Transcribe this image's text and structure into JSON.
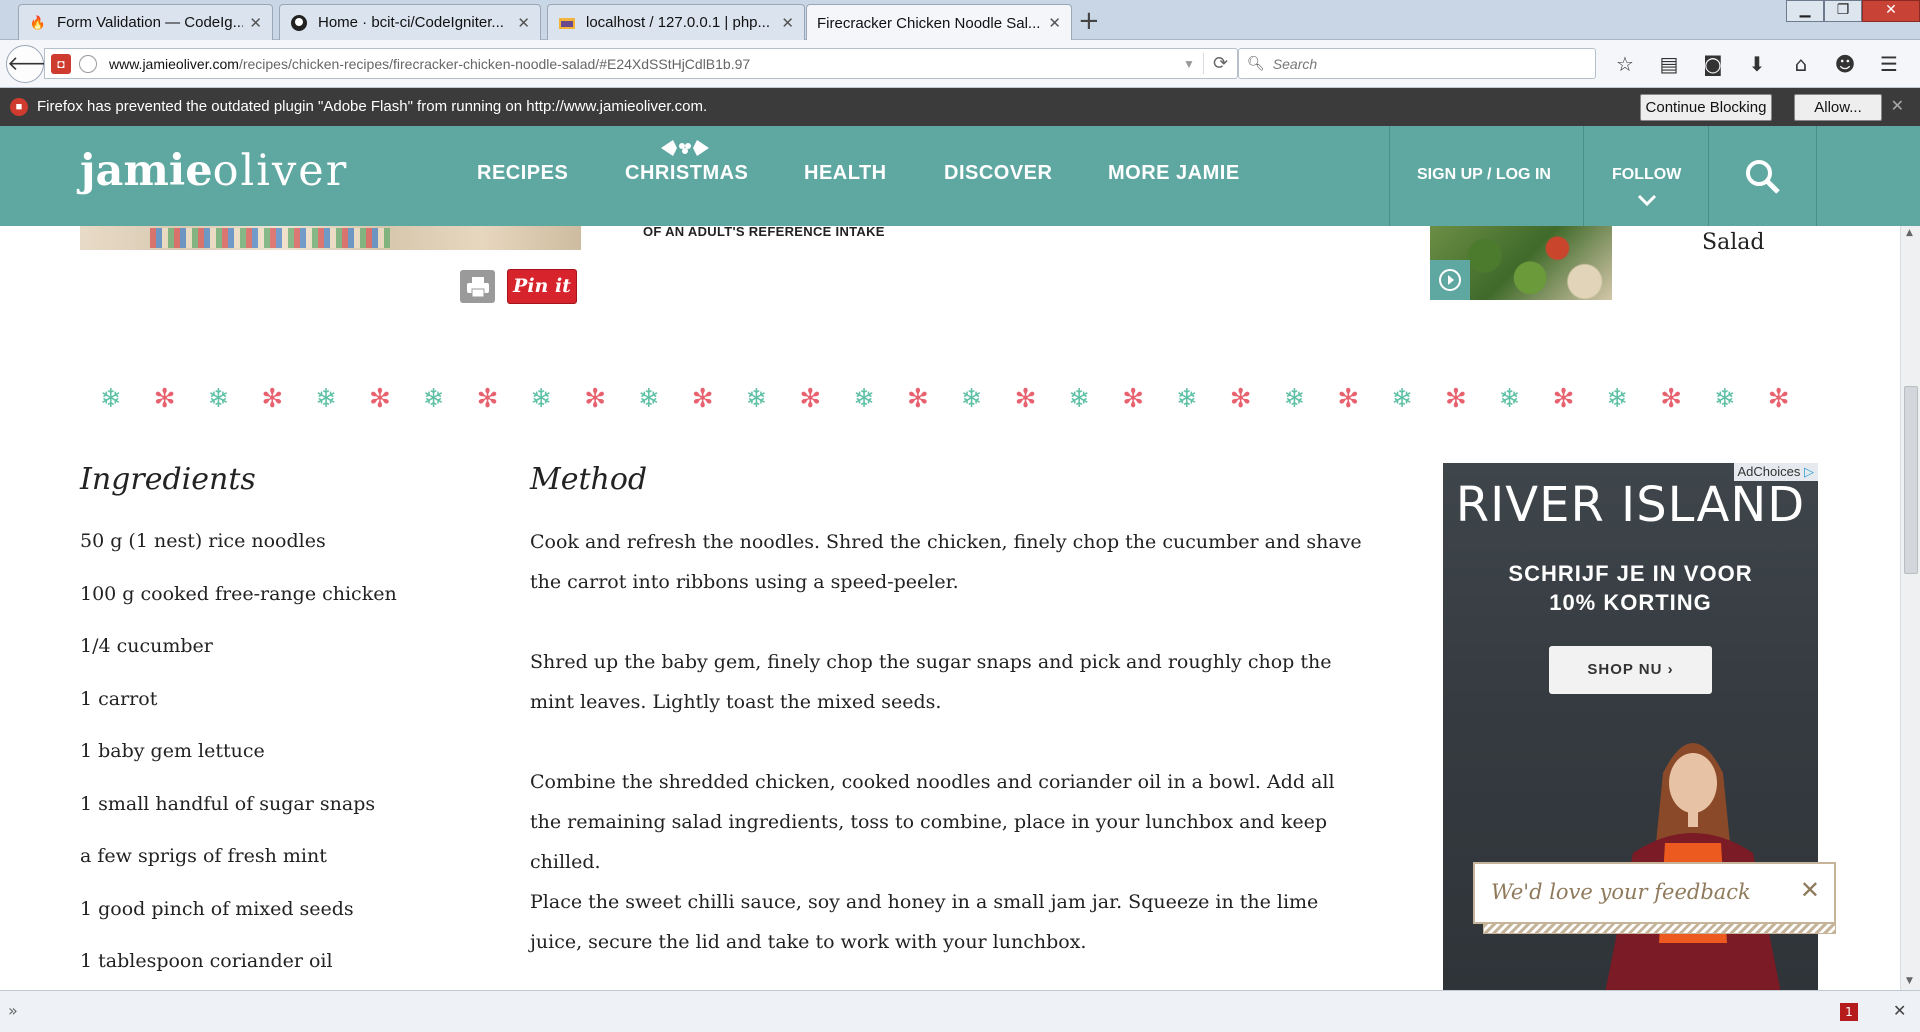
{
  "browser": {
    "tabs": [
      {
        "title": "Form Validation — CodeIg...",
        "favicon": "flame-icon"
      },
      {
        "title": "Home · bcit-ci/CodeIgniter...",
        "favicon": "github-icon"
      },
      {
        "title": "localhost / 127.0.0.1 | php...",
        "favicon": "phpmyadmin-icon"
      },
      {
        "title": "Firecracker Chicken Noodle Sal...",
        "favicon": "none",
        "active": true
      }
    ],
    "url_domain": "www.jamieoliver.com",
    "url_path": "/recipes/chicken-recipes/firecracker-chicken-noodle-salad/#E24XdSStHjCdlB1b.97",
    "search_placeholder": "Search",
    "plugin_notice": {
      "message": "Firefox has prevented the outdated plugin \"Adobe Flash\" from running on http://www.jamieoliver.com.",
      "continue_label": "Continue Blocking",
      "allow_label": "Allow..."
    },
    "addon_badge": "1"
  },
  "site": {
    "logo_bold": "jamie",
    "logo_light": "oliver",
    "nav": [
      "RECIPES",
      "CHRISTMAS",
      "HEALTH",
      "DISCOVER",
      "MORE JAMIE"
    ],
    "signup_label": "SIGN UP / LOG IN",
    "follow_label": "FOLLOW"
  },
  "content": {
    "intake_text": "OF AN ADULT'S REFERENCE INTAKE",
    "pin_label": "Pin it",
    "related_title": "Salad",
    "ingredients_heading": "Ingredients",
    "ingredients": [
      "50 g (1 nest) rice noodles",
      "100 g cooked free-range chicken",
      "1/4 cucumber",
      "1 carrot",
      "1 baby gem lettuce",
      "1 small handful of sugar snaps",
      "a few sprigs of fresh mint",
      "1 good pinch of mixed seeds",
      "1 tablespoon coriander oil"
    ],
    "method_heading": "Method",
    "method": [
      "Cook and refresh the noodles. Shred the chicken, finely chop the cucumber and shave the carrot into ribbons using a speed-peeler.",
      "Shred up the baby gem, finely chop the sugar snaps and pick and roughly chop the mint leaves. Lightly toast the mixed seeds.",
      "Combine the shredded chicken, cooked noodles and coriander oil in a bowl. Add all the remaining salad ingredients, toss to combine, place in your lunchbox and keep chilled.",
      "Place the sweet chilli sauce, soy and honey in a small jam jar. Squeeze in the lime juice, secure the lid and take to work with your lunchbox."
    ]
  },
  "ad": {
    "choices_label": "AdChoices",
    "brand": "RIVER ISLAND",
    "promo_line1": "SCHRIJF JE IN VOOR",
    "promo_line2": "10% KORTING",
    "cta": "SHOP NU ›"
  },
  "feedback": {
    "label": "We'd love your feedback",
    "close": "✕"
  },
  "colors": {
    "header_teal": "#5fa8a2",
    "snow_teal": "#5ec0a4",
    "snow_red": "#e8616e",
    "pinterest": "#d7232c"
  }
}
